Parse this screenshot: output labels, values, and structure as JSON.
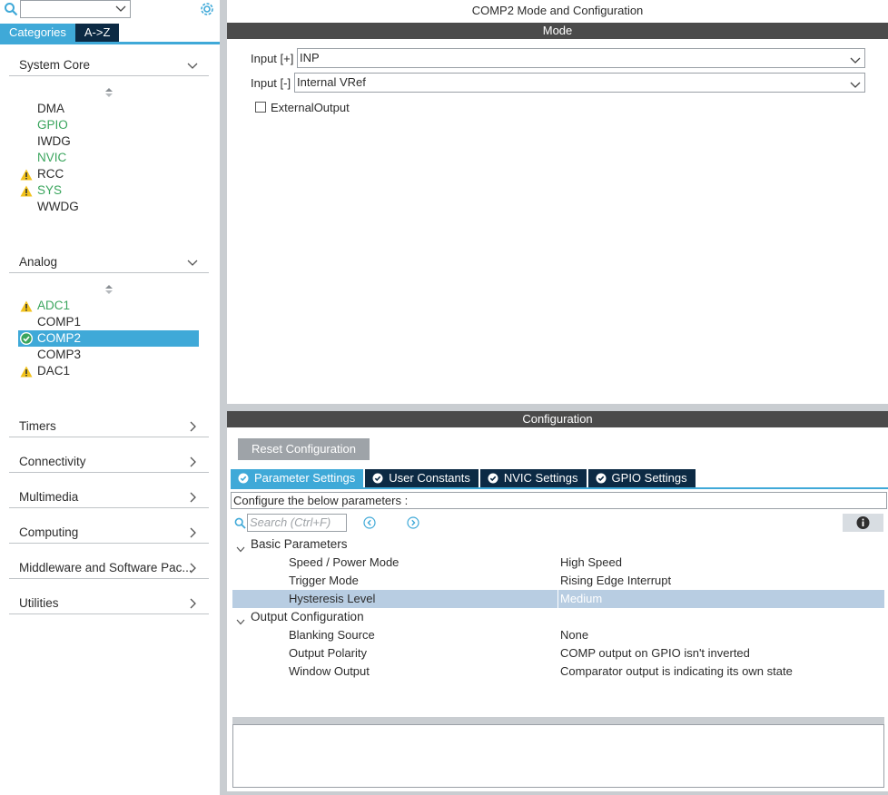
{
  "left_panel": {
    "tabs": {
      "categories": "Categories",
      "az": "A->Z"
    },
    "sections": {
      "system_core": {
        "label": "System Core",
        "items": [
          "DMA",
          "GPIO",
          "IWDG",
          "NVIC",
          "RCC",
          "SYS",
          "WWDG"
        ]
      },
      "analog": {
        "label": "Analog",
        "items": [
          "ADC1",
          "COMP1",
          "COMP2",
          "COMP3",
          "DAC1"
        ]
      },
      "timers": {
        "label": "Timers"
      },
      "connectivity": {
        "label": "Connectivity"
      },
      "multimedia": {
        "label": "Multimedia"
      },
      "computing": {
        "label": "Computing"
      },
      "middleware": {
        "label": "Middleware and Software Pac..."
      },
      "utilities": {
        "label": "Utilities"
      }
    }
  },
  "main": {
    "title": "COMP2 Mode and Configuration",
    "mode": {
      "header": "Mode",
      "input_plus": {
        "label": "Input [+]",
        "value": "INP"
      },
      "input_minus": {
        "label": "Input [-]",
        "value": "Internal VRef"
      },
      "external_output": {
        "label": "ExternalOutput",
        "checked": false
      }
    },
    "configuration": {
      "header": "Configuration",
      "reset_button": "Reset Configuration",
      "tabs": [
        "Parameter Settings",
        "User Constants",
        "NVIC Settings",
        "GPIO Settings"
      ],
      "description": "Configure the below parameters :",
      "search_placeholder": "Search (Ctrl+F)",
      "groups": {
        "basic": {
          "label": "Basic Parameters",
          "params": [
            {
              "name": "Speed / Power Mode",
              "value": "High Speed"
            },
            {
              "name": "Trigger Mode",
              "value": "Rising Edge Interrupt"
            },
            {
              "name": "Hysteresis Level",
              "value": "Medium"
            }
          ]
        },
        "output": {
          "label": "Output Configuration",
          "params": [
            {
              "name": "Blanking Source",
              "value": "None"
            },
            {
              "name": "Output Polarity",
              "value": "COMP output on GPIO isn't inverted"
            },
            {
              "name": "Window Output",
              "value": "Comparator output is indicating its own state"
            }
          ]
        }
      }
    }
  },
  "colors": {
    "accent": "#3fa9d8",
    "navy": "#0c2a44",
    "green": "#3aa55d",
    "warning": "#f2c21b",
    "header_bar": "#4b4b4b",
    "highlight_row": "#b8cde2"
  }
}
